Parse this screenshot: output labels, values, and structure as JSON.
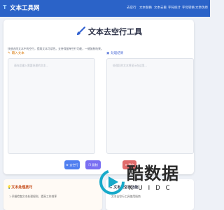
{
  "header": {
    "logo_mark": "T",
    "logo_text": "文本工具网",
    "nav": [
      "去空行",
      "文本替换",
      "文本去重",
      "字符统计",
      "字母转换",
      "文章伪原"
    ]
  },
  "main": {
    "title": "文本去空行工具",
    "intro": "快速去除文本中的空行，提高文本可读性。支持保留单空行功能，一键复制结果。",
    "input_label": "输入文本",
    "input_placeholder": "请在此输入需要处理的文本...",
    "output_label": "处理结果",
    "output_placeholder": "处理后的文本将显示在这里...",
    "buttons": {
      "process": "去空行",
      "copy": "复制",
      "clear": "清空"
    }
  },
  "tips": {
    "title": "文本处理技巧",
    "item": "1 仔细检查文本处理规则，提高工作效率"
  },
  "funcs": {
    "title": "文本去空行功能",
    "item": "文本去空行工具使用指南"
  },
  "watermark": {
    "main": "酷数据",
    "sub": "KUIDC"
  },
  "colors": {
    "header": "#2b63c8",
    "accent_blue": "#4f7ff0",
    "accent_purple": "#7a6ff2",
    "accent_red": "#e06a6a"
  }
}
